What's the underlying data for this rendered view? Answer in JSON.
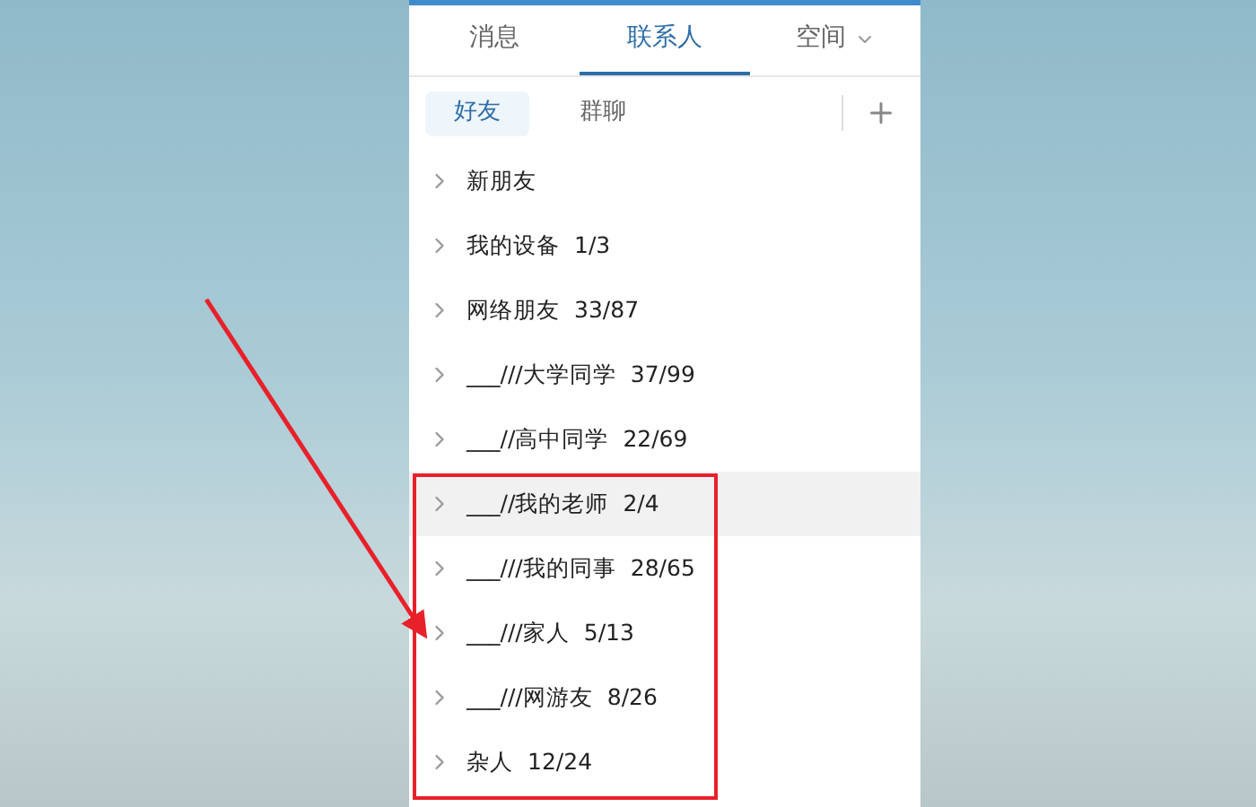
{
  "tabs": [
    {
      "label": "消息",
      "selected": false,
      "dropdown": false
    },
    {
      "label": "联系人",
      "selected": true,
      "dropdown": false
    },
    {
      "label": "空间",
      "selected": false,
      "dropdown": true
    }
  ],
  "subtabs": [
    {
      "label": "好友",
      "selected": true
    },
    {
      "label": "群聊",
      "selected": false
    }
  ],
  "groups": [
    {
      "name": "新朋友",
      "highlighted": false
    },
    {
      "name": "我的设备",
      "count": "1/3",
      "highlighted": false
    },
    {
      "name": "网络朋友",
      "count": "33/87",
      "highlighted": false
    },
    {
      "name": "___///大学同学",
      "count": "37/99",
      "highlighted": false
    },
    {
      "name": "___//高中同学",
      "count": "22/69",
      "highlighted": false
    },
    {
      "name": "___//我的老师",
      "count": "2/4",
      "highlighted": true
    },
    {
      "name": "___///我的同事",
      "count": "28/65",
      "highlighted": false
    },
    {
      "name": "___///家人",
      "count": "5/13",
      "highlighted": false
    },
    {
      "name": "___///网游友",
      "count": "8/26",
      "highlighted": false
    },
    {
      "name": "杂人",
      "count": "12/24",
      "highlighted": false
    }
  ]
}
